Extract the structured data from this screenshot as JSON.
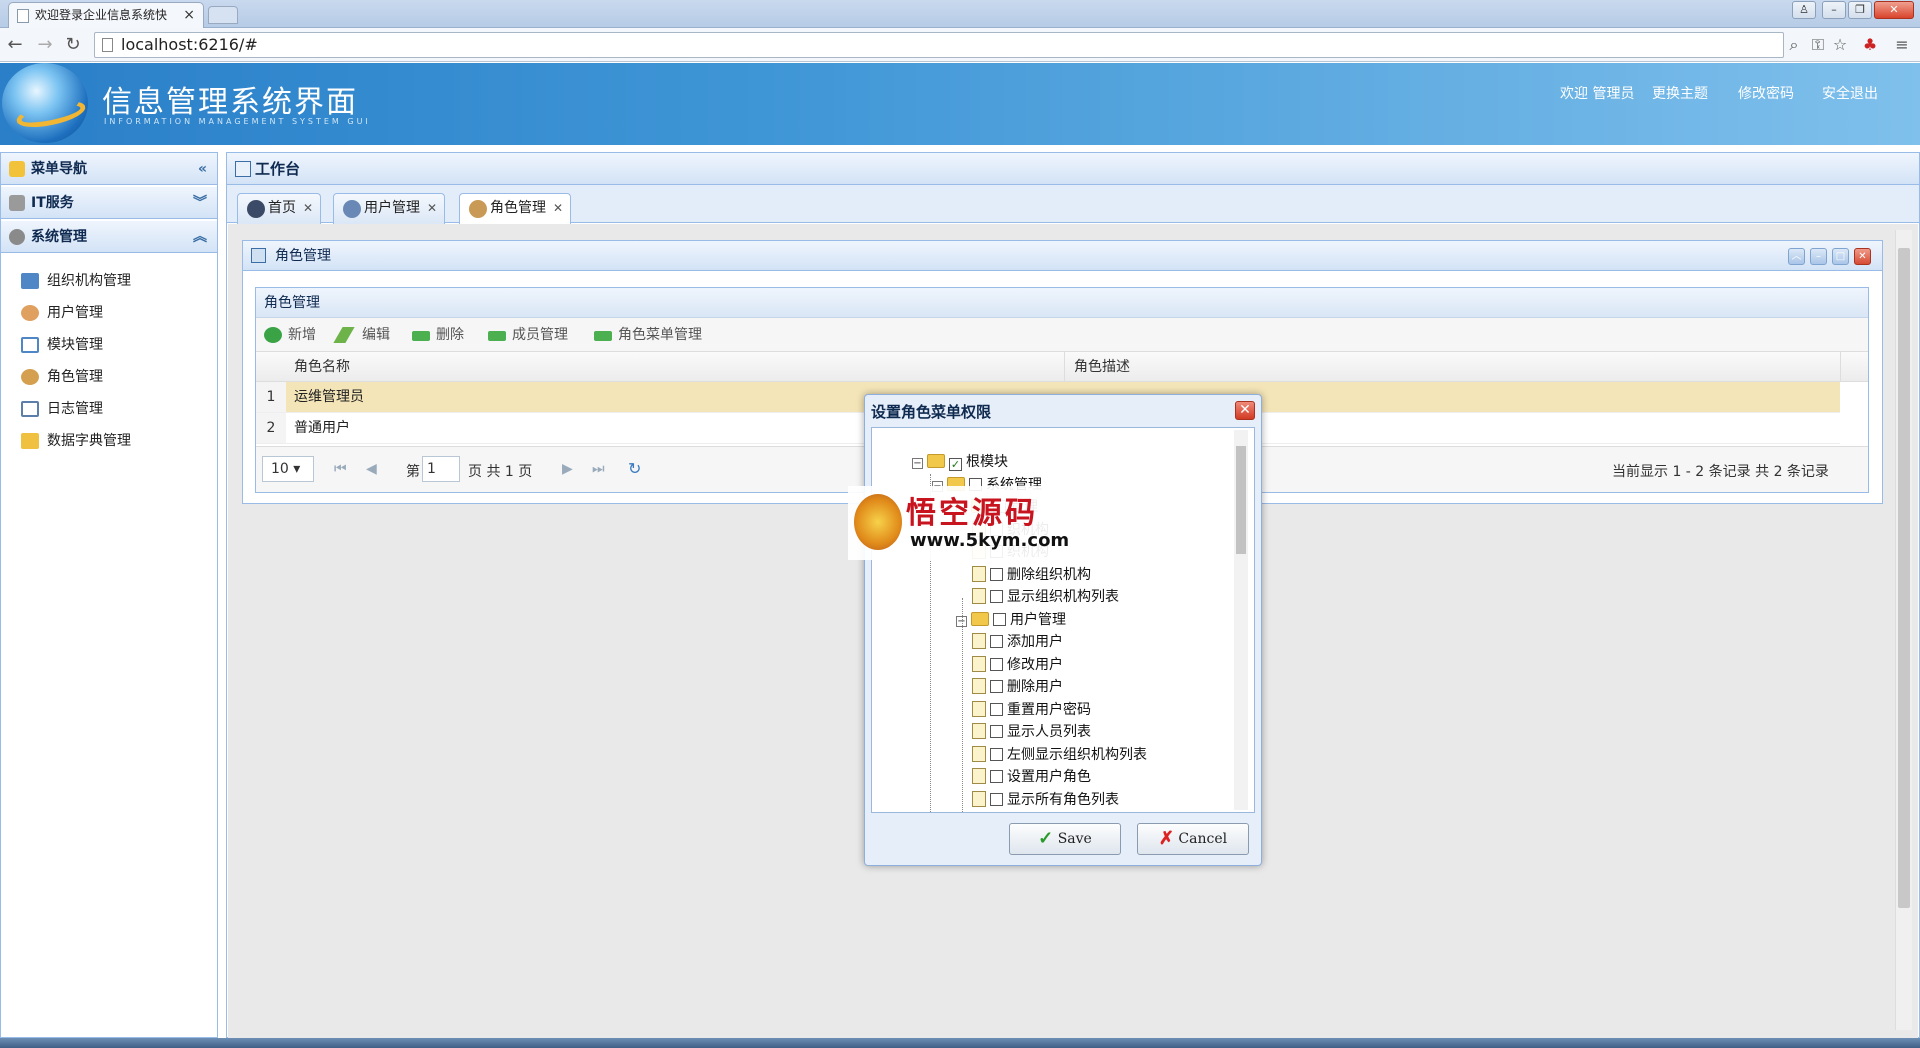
{
  "browser": {
    "tab_title": "欢迎登录企业信息系统快",
    "address": "localhost:6216/#"
  },
  "header": {
    "title": "信息管理系统界面",
    "subtitle": "INFORMATION MANAGEMENT SYSTEM GUI",
    "welcome": "欢迎 管理员",
    "change_theme": "更换主题",
    "change_password": "修改密码",
    "logout": "安全退出"
  },
  "sidebar": {
    "title": "菜单导航",
    "groups": [
      {
        "label": "IT服务",
        "expanded": false
      },
      {
        "label": "系统管理",
        "expanded": true
      }
    ],
    "items": [
      {
        "label": "组织机构管理",
        "icon": "org-icon"
      },
      {
        "label": "用户管理",
        "icon": "user-icon"
      },
      {
        "label": "模块管理",
        "icon": "module-icon"
      },
      {
        "label": "角色管理",
        "icon": "role-icon"
      },
      {
        "label": "日志管理",
        "icon": "log-icon"
      },
      {
        "label": "数据字典管理",
        "icon": "dictionary-icon"
      }
    ]
  },
  "main": {
    "title": "工作台",
    "tabs": [
      {
        "label": "首页",
        "active": false
      },
      {
        "label": "用户管理",
        "active": false
      },
      {
        "label": "角色管理",
        "active": true
      }
    ]
  },
  "role_panel": {
    "title": "角色管理",
    "grid_title": "角色管理",
    "toolbar": {
      "add": "新增",
      "edit": "编辑",
      "delete": "删除",
      "members": "成员管理",
      "role_menu": "角色菜单管理"
    },
    "columns": [
      "角色名称",
      "角色描述"
    ],
    "rows": [
      {
        "num": "1",
        "name": "运维管理员",
        "selected": true
      },
      {
        "num": "2",
        "name": "普通用户",
        "selected": false
      }
    ],
    "pager": {
      "page_size": "10 ▾",
      "page_label_pre": "第",
      "page_value": "1",
      "page_label_post": "页 共 1 页",
      "status": "当前显示 1 - 2 条记录 共 2 条记录"
    }
  },
  "dialog": {
    "title": "设置角色菜单权限",
    "tree": [
      {
        "label": "根模块",
        "level": 0,
        "type": "folder",
        "checked": true
      },
      {
        "label": "系统管理",
        "level": 1,
        "type": "folder",
        "checked": false
      },
      {
        "label": "管理",
        "level": 2,
        "type": "folder",
        "checked": false
      },
      {
        "label": "织机构",
        "level": 3,
        "type": "leaf",
        "checked": false
      },
      {
        "label": "织机构",
        "level": 3,
        "type": "leaf",
        "checked": false
      },
      {
        "label": "删除组织机构",
        "level": 3,
        "type": "leaf",
        "checked": false
      },
      {
        "label": "显示组织机构列表",
        "level": 3,
        "type": "leaf",
        "checked": false
      },
      {
        "label": "用户管理",
        "level": 2,
        "type": "folder",
        "checked": false
      },
      {
        "label": "添加用户",
        "level": 3,
        "type": "leaf",
        "checked": false
      },
      {
        "label": "修改用户",
        "level": 3,
        "type": "leaf",
        "checked": false
      },
      {
        "label": "删除用户",
        "level": 3,
        "type": "leaf",
        "checked": false
      },
      {
        "label": "重置用户密码",
        "level": 3,
        "type": "leaf",
        "checked": false
      },
      {
        "label": "显示人员列表",
        "level": 3,
        "type": "leaf",
        "checked": false
      },
      {
        "label": "左侧显示组织机构列表",
        "level": 3,
        "type": "leaf",
        "checked": false
      },
      {
        "label": "设置用户角色",
        "level": 3,
        "type": "leaf",
        "checked": false
      },
      {
        "label": "显示所有角色列表",
        "level": 3,
        "type": "leaf",
        "checked": false
      }
    ],
    "save": "Save",
    "cancel": "Cancel"
  },
  "watermark": {
    "text": "悟空源码",
    "url": "www.5kym.com"
  },
  "colors": {
    "header_blue": "#3f96d6",
    "panel_border": "#99bbe8",
    "selected_row": "#f4e5b8",
    "close_red": "#d13b23"
  }
}
